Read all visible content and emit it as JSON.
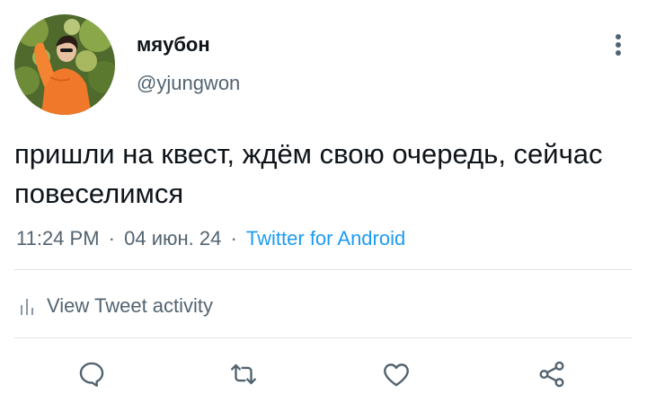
{
  "user": {
    "display_name": "мяубон",
    "handle": "@yjungwon",
    "avatar_icon": "profile-photo"
  },
  "tweet": {
    "text": "пришли на квест, ждём свою очередь, сейчас повеселимся",
    "time": "11:24 PM",
    "date": "04 июн. 24",
    "separator": "·",
    "source": "Twitter for Android"
  },
  "activity": {
    "label": "View Tweet activity",
    "icon": "bar-chart-icon"
  },
  "actions": {
    "reply_icon": "reply-icon",
    "retweet_icon": "retweet-icon",
    "like_icon": "heart-icon",
    "share_icon": "share-icon"
  },
  "colors": {
    "text": "#0f1419",
    "secondary": "#536471",
    "link": "#1d9bf0",
    "divider": "#e1e5e8"
  }
}
